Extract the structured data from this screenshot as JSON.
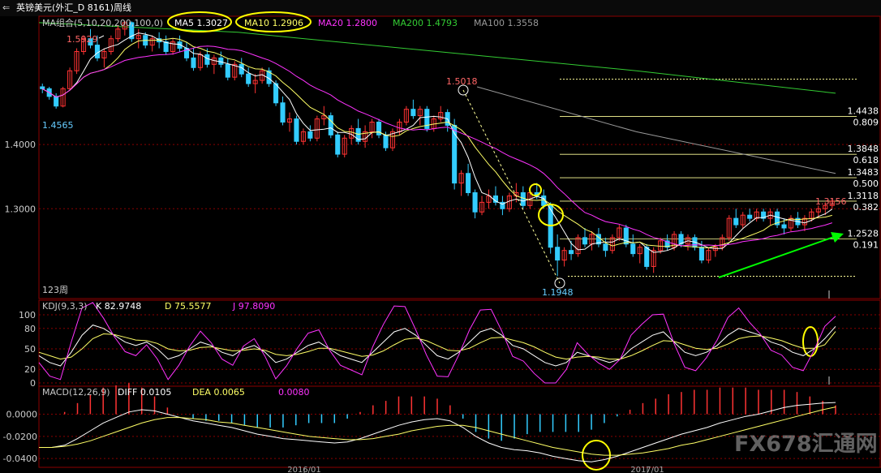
{
  "title": "英镑美元(外汇_D 8161)周线",
  "period_label": "123周",
  "watermark": "FX678汇通网",
  "main_legend": [
    {
      "label": "MA组合(5,10,20,200,100,0)",
      "color": "#c8c8c8"
    },
    {
      "label": "MA5 1.3027",
      "color": "#ffffff"
    },
    {
      "label": "MA10 1.2906",
      "color": "#ffff66"
    },
    {
      "label": "MA20 1.2800",
      "color": "#ff33ff"
    },
    {
      "label": "MA200 1.4793",
      "color": "#33cc33"
    },
    {
      "label": "MA100 1.3558",
      "color": "#999999"
    }
  ],
  "kdj_legend": [
    {
      "label": "KDJ(9,3,3)",
      "color": "#c8c8c8"
    },
    {
      "label": "K 82.9748",
      "color": "#ffffff"
    },
    {
      "label": "D 75.5577",
      "color": "#ffff66"
    },
    {
      "label": "J 97.8090",
      "color": "#ff33ff"
    }
  ],
  "macd_legend": [
    {
      "label": "MACD(12,26,9)",
      "color": "#c8c8c8"
    },
    {
      "label": "DIFF 0.0105",
      "color": "#ffffff"
    },
    {
      "label": "DEA 0.0065",
      "color": "#ffff66"
    },
    {
      "label": "0.0080",
      "color": "#ff33ff"
    }
  ],
  "colors": {
    "up": "#ff3333",
    "down": "#33ccff",
    "grid": "#8b0000",
    "fib": "#ffff99",
    "annot": "#ffff00",
    "arrow": "#00ff00"
  },
  "chart_data": [
    {
      "type": "candlestick",
      "panel": "price",
      "y_ticks": [
        1.3,
        1.4
      ],
      "ylim": [
        1.16,
        1.6
      ],
      "x_labels": [
        "2016/01",
        "2017/01"
      ],
      "annotations": [
        {
          "label": "1.5929",
          "price": 1.5929,
          "color": "#ff6666"
        },
        {
          "label": "1.4565",
          "price": 1.4565,
          "color": "#66ccff"
        },
        {
          "label": "1.5018",
          "price": 1.5018,
          "color": "#ff6666"
        },
        {
          "label": "1.1948",
          "price": 1.1948,
          "color": "#66ccff"
        },
        {
          "label": "1.3156",
          "price": 1.3156,
          "color": "#ff6666"
        }
      ],
      "fibonacci": [
        {
          "price": 1.4438,
          "ratio": "0.809"
        },
        {
          "price": 1.3848,
          "ratio": "0.618"
        },
        {
          "price": 1.3483,
          "ratio": "0.500"
        },
        {
          "price": 1.3118,
          "ratio": "0.382"
        },
        {
          "price": 1.2528,
          "ratio": "0.191"
        }
      ],
      "candles_ohlc": [
        [
          1.49,
          1.495,
          1.48,
          1.487
        ],
        [
          1.487,
          1.49,
          1.47,
          1.475
        ],
        [
          1.475,
          1.48,
          1.456,
          1.46
        ],
        [
          1.46,
          1.49,
          1.458,
          1.487
        ],
        [
          1.487,
          1.52,
          1.485,
          1.515
        ],
        [
          1.515,
          1.55,
          1.51,
          1.545
        ],
        [
          1.545,
          1.57,
          1.54,
          1.565
        ],
        [
          1.565,
          1.58,
          1.55,
          1.555
        ],
        [
          1.555,
          1.57,
          1.53,
          1.535
        ],
        [
          1.535,
          1.55,
          1.52,
          1.545
        ],
        [
          1.545,
          1.57,
          1.54,
          1.565
        ],
        [
          1.565,
          1.585,
          1.56,
          1.58
        ],
        [
          1.58,
          1.593,
          1.57,
          1.59
        ],
        [
          1.59,
          1.592,
          1.56,
          1.565
        ],
        [
          1.565,
          1.58,
          1.55,
          1.57
        ],
        [
          1.57,
          1.575,
          1.55,
          1.555
        ],
        [
          1.555,
          1.57,
          1.545,
          1.565
        ],
        [
          1.565,
          1.575,
          1.55,
          1.56
        ],
        [
          1.56,
          1.57,
          1.54,
          1.545
        ],
        [
          1.545,
          1.565,
          1.54,
          1.56
        ],
        [
          1.56,
          1.57,
          1.545,
          1.55
        ],
        [
          1.55,
          1.56,
          1.53,
          1.535
        ],
        [
          1.535,
          1.55,
          1.515,
          1.52
        ],
        [
          1.52,
          1.545,
          1.515,
          1.54
        ],
        [
          1.54,
          1.55,
          1.52,
          1.525
        ],
        [
          1.525,
          1.54,
          1.51,
          1.535
        ],
        [
          1.535,
          1.545,
          1.52,
          1.525
        ],
        [
          1.525,
          1.535,
          1.5,
          1.505
        ],
        [
          1.505,
          1.53,
          1.5,
          1.525
        ],
        [
          1.525,
          1.535,
          1.505,
          1.51
        ],
        [
          1.51,
          1.52,
          1.49,
          1.495
        ],
        [
          1.495,
          1.51,
          1.48,
          1.5
        ],
        [
          1.5,
          1.52,
          1.495,
          1.515
        ],
        [
          1.515,
          1.52,
          1.49,
          1.495
        ],
        [
          1.495,
          1.5,
          1.46,
          1.465
        ],
        [
          1.465,
          1.475,
          1.43,
          1.435
        ],
        [
          1.435,
          1.45,
          1.42,
          1.44
        ],
        [
          1.44,
          1.445,
          1.4,
          1.405
        ],
        [
          1.405,
          1.425,
          1.4,
          1.42
        ],
        [
          1.42,
          1.43,
          1.405,
          1.41
        ],
        [
          1.41,
          1.445,
          1.405,
          1.44
        ],
        [
          1.44,
          1.46,
          1.43,
          1.445
        ],
        [
          1.445,
          1.45,
          1.41,
          1.415
        ],
        [
          1.415,
          1.42,
          1.38,
          1.385
        ],
        [
          1.385,
          1.415,
          1.38,
          1.41
        ],
        [
          1.41,
          1.43,
          1.4,
          1.425
        ],
        [
          1.425,
          1.44,
          1.4,
          1.405
        ],
        [
          1.405,
          1.43,
          1.395,
          1.42
        ],
        [
          1.42,
          1.44,
          1.41,
          1.435
        ],
        [
          1.435,
          1.44,
          1.41,
          1.415
        ],
        [
          1.415,
          1.42,
          1.39,
          1.395
        ],
        [
          1.395,
          1.425,
          1.39,
          1.42
        ],
        [
          1.42,
          1.44,
          1.415,
          1.435
        ],
        [
          1.435,
          1.46,
          1.43,
          1.455
        ],
        [
          1.455,
          1.47,
          1.44,
          1.445
        ],
        [
          1.445,
          1.46,
          1.43,
          1.455
        ],
        [
          1.455,
          1.46,
          1.42,
          1.425
        ],
        [
          1.425,
          1.445,
          1.42,
          1.44
        ],
        [
          1.44,
          1.46,
          1.435,
          1.45
        ],
        [
          1.45,
          1.455,
          1.42,
          1.43
        ],
        [
          1.43,
          1.44,
          1.33,
          1.34
        ],
        [
          1.34,
          1.36,
          1.32,
          1.355
        ],
        [
          1.355,
          1.37,
          1.32,
          1.325
        ],
        [
          1.325,
          1.33,
          1.285,
          1.295
        ],
        [
          1.295,
          1.32,
          1.29,
          1.31
        ],
        [
          1.31,
          1.33,
          1.3,
          1.32
        ],
        [
          1.32,
          1.335,
          1.305,
          1.31
        ],
        [
          1.31,
          1.32,
          1.29,
          1.3
        ],
        [
          1.3,
          1.325,
          1.295,
          1.32
        ],
        [
          1.32,
          1.34,
          1.31,
          1.325
        ],
        [
          1.325,
          1.335,
          1.3,
          1.305
        ],
        [
          1.305,
          1.33,
          1.3,
          1.325
        ],
        [
          1.325,
          1.34,
          1.315,
          1.32
        ],
        [
          1.32,
          1.33,
          1.3,
          1.305
        ],
        [
          1.305,
          1.31,
          1.23,
          1.24
        ],
        [
          1.24,
          1.26,
          1.195,
          1.22
        ],
        [
          1.22,
          1.24,
          1.21,
          1.235
        ],
        [
          1.235,
          1.25,
          1.22,
          1.23
        ],
        [
          1.23,
          1.26,
          1.225,
          1.255
        ],
        [
          1.255,
          1.27,
          1.24,
          1.245
        ],
        [
          1.245,
          1.265,
          1.235,
          1.26
        ],
        [
          1.26,
          1.27,
          1.24,
          1.245
        ],
        [
          1.245,
          1.255,
          1.225,
          1.235
        ],
        [
          1.235,
          1.26,
          1.23,
          1.255
        ],
        [
          1.255,
          1.275,
          1.25,
          1.27
        ],
        [
          1.27,
          1.275,
          1.24,
          1.245
        ],
        [
          1.245,
          1.26,
          1.225,
          1.23
        ],
        [
          1.23,
          1.245,
          1.215,
          1.24
        ],
        [
          1.24,
          1.245,
          1.205,
          1.21
        ],
        [
          1.21,
          1.24,
          1.2,
          1.235
        ],
        [
          1.235,
          1.255,
          1.23,
          1.25
        ],
        [
          1.25,
          1.26,
          1.235,
          1.24
        ],
        [
          1.24,
          1.265,
          1.235,
          1.26
        ],
        [
          1.26,
          1.265,
          1.24,
          1.245
        ],
        [
          1.245,
          1.26,
          1.235,
          1.255
        ],
        [
          1.255,
          1.26,
          1.235,
          1.24
        ],
        [
          1.24,
          1.25,
          1.215,
          1.22
        ],
        [
          1.22,
          1.24,
          1.215,
          1.235
        ],
        [
          1.235,
          1.245,
          1.225,
          1.24
        ],
        [
          1.24,
          1.26,
          1.235,
          1.255
        ],
        [
          1.255,
          1.29,
          1.25,
          1.285
        ],
        [
          1.285,
          1.3,
          1.27,
          1.275
        ],
        [
          1.275,
          1.295,
          1.27,
          1.29
        ],
        [
          1.29,
          1.3,
          1.28,
          1.285
        ],
        [
          1.285,
          1.3,
          1.28,
          1.295
        ],
        [
          1.295,
          1.3,
          1.28,
          1.285
        ],
        [
          1.285,
          1.3,
          1.275,
          1.295
        ],
        [
          1.295,
          1.3,
          1.27,
          1.275
        ],
        [
          1.275,
          1.285,
          1.26,
          1.27
        ],
        [
          1.27,
          1.29,
          1.265,
          1.285
        ],
        [
          1.285,
          1.295,
          1.27,
          1.275
        ],
        [
          1.275,
          1.29,
          1.265,
          1.285
        ],
        [
          1.285,
          1.3,
          1.28,
          1.295
        ],
        [
          1.295,
          1.305,
          1.285,
          1.3
        ],
        [
          1.3,
          1.31,
          1.29,
          1.305
        ],
        [
          1.305,
          1.316,
          1.3,
          1.312
        ]
      ],
      "moving_averages": {
        "MA200": [
          [
            0,
            1.59
          ],
          [
            0.25,
            1.575
          ],
          [
            0.5,
            1.545
          ],
          [
            0.75,
            1.515
          ],
          [
            1,
            1.48
          ]
        ],
        "MA100": [
          [
            0.55,
            1.49
          ],
          [
            0.75,
            1.42
          ],
          [
            1,
            1.355
          ]
        ]
      }
    },
    {
      "type": "line",
      "panel": "KDJ",
      "y_ticks": [
        0,
        20,
        50,
        80,
        100
      ],
      "ylim": [
        0,
        100
      ],
      "series": [
        {
          "name": "K",
          "values": [
            40,
            30,
            25,
            45,
            70,
            85,
            80,
            70,
            60,
            55,
            60,
            50,
            35,
            40,
            50,
            60,
            55,
            45,
            40,
            50,
            55,
            45,
            30,
            35,
            45,
            55,
            60,
            50,
            40,
            35,
            30,
            45,
            60,
            75,
            80,
            70,
            55,
            40,
            35,
            45,
            60,
            75,
            80,
            70,
            55,
            50,
            40,
            30,
            25,
            30,
            45,
            40,
            35,
            30,
            35,
            50,
            60,
            70,
            75,
            60,
            45,
            40,
            45,
            55,
            70,
            80,
            75,
            70,
            60,
            55,
            45,
            40,
            50,
            65,
            83
          ]
        },
        {
          "name": "D",
          "values": [
            45,
            40,
            35,
            38,
            50,
            65,
            72,
            71,
            67,
            63,
            62,
            58,
            50,
            47,
            48,
            52,
            53,
            50,
            47,
            48,
            50,
            48,
            42,
            40,
            42,
            46,
            51,
            51,
            47,
            43,
            39,
            41,
            47,
            56,
            64,
            66,
            62,
            55,
            48,
            47,
            51,
            59,
            66,
            67,
            63,
            59,
            53,
            45,
            38,
            35,
            38,
            39,
            38,
            35,
            35,
            40,
            47,
            55,
            62,
            61,
            56,
            51,
            49,
            51,
            57,
            65,
            68,
            69,
            66,
            62,
            56,
            51,
            51,
            56,
            75.5
          ]
        },
        {
          "name": "J",
          "values": [
            30,
            10,
            5,
            60,
            110,
            120,
            95,
            68,
            46,
            40,
            56,
            35,
            5,
            26,
            54,
            76,
            59,
            35,
            26,
            54,
            65,
            39,
            6,
            25,
            51,
            73,
            78,
            48,
            26,
            19,
            12,
            53,
            86,
            113,
            112,
            78,
            41,
            10,
            9,
            41,
            78,
            107,
            108,
            76,
            39,
            32,
            14,
            0,
            0,
            20,
            59,
            42,
            29,
            20,
            35,
            70,
            86,
            100,
            101,
            58,
            23,
            18,
            37,
            63,
            96,
            110,
            89,
            72,
            48,
            41,
            23,
            18,
            48,
            83,
            97.8
          ]
        }
      ]
    },
    {
      "type": "bar+line",
      "panel": "MACD",
      "y_ticks": [
        0.0,
        -0.02,
        -0.04
      ],
      "ylim": [
        -0.045,
        0.015
      ],
      "series": [
        {
          "name": "DIFF",
          "values": [
            -0.03,
            -0.03,
            -0.028,
            -0.022,
            -0.015,
            -0.008,
            -0.003,
            0.002,
            0.004,
            0.003,
            0.0,
            -0.003,
            -0.006,
            -0.008,
            -0.01,
            -0.012,
            -0.015,
            -0.018,
            -0.02,
            -0.022,
            -0.023,
            -0.024,
            -0.025,
            -0.026,
            -0.025,
            -0.022,
            -0.018,
            -0.014,
            -0.01,
            -0.007,
            -0.005,
            -0.004,
            -0.006,
            -0.012,
            -0.02,
            -0.026,
            -0.03,
            -0.032,
            -0.033,
            -0.035,
            -0.038,
            -0.04,
            -0.042,
            -0.043,
            -0.041,
            -0.038,
            -0.034,
            -0.03,
            -0.026,
            -0.022,
            -0.018,
            -0.015,
            -0.012,
            -0.008,
            -0.005,
            -0.002,
            0.0,
            0.003,
            0.006,
            0.008,
            0.009,
            0.01,
            0.0105
          ]
        },
        {
          "name": "DEA",
          "values": [
            -0.03,
            -0.03,
            -0.029,
            -0.027,
            -0.024,
            -0.02,
            -0.016,
            -0.012,
            -0.008,
            -0.005,
            -0.003,
            -0.003,
            -0.004,
            -0.005,
            -0.007,
            -0.008,
            -0.01,
            -0.012,
            -0.014,
            -0.016,
            -0.018,
            -0.02,
            -0.021,
            -0.022,
            -0.023,
            -0.023,
            -0.022,
            -0.02,
            -0.018,
            -0.015,
            -0.013,
            -0.011,
            -0.01,
            -0.01,
            -0.012,
            -0.015,
            -0.018,
            -0.021,
            -0.024,
            -0.027,
            -0.03,
            -0.032,
            -0.034,
            -0.036,
            -0.037,
            -0.037,
            -0.036,
            -0.035,
            -0.033,
            -0.031,
            -0.028,
            -0.026,
            -0.023,
            -0.02,
            -0.017,
            -0.014,
            -0.011,
            -0.008,
            -0.005,
            -0.002,
            0.001,
            0.004,
            0.0065
          ]
        }
      ]
    }
  ]
}
